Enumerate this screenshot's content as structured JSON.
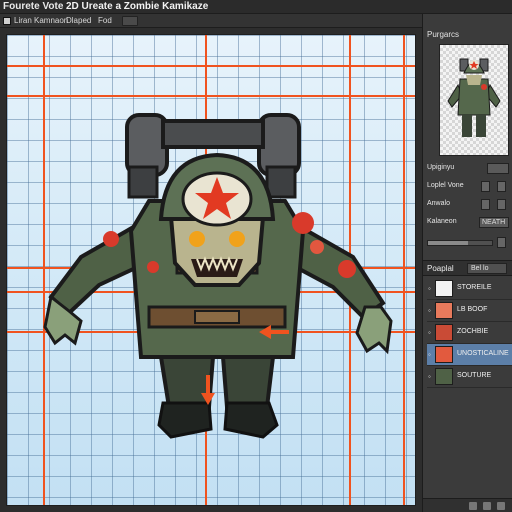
{
  "titlebar": {
    "app_title": "Fourete Vote",
    "document_title": "2D Ureate a Zombie Kamikaze"
  },
  "options_bar": {
    "left_label": "Liran Kamnaon",
    "middle_label": "Dlaped",
    "right_label": "Fod"
  },
  "panel": {
    "tab_title": "Purgarcs",
    "properties": [
      {
        "label": "Upiginyu",
        "value": ""
      },
      {
        "label": "Loplel Vone",
        "value": ""
      },
      {
        "label": "Anwalo",
        "value": ""
      },
      {
        "label": "Kalaneon",
        "value": "NEATH"
      }
    ],
    "layers_title": "Poaplal",
    "layers_mode": "Bel lo",
    "layers": [
      {
        "name": "STOREILE",
        "selected": false
      },
      {
        "name": "LB BOOF",
        "selected": false
      },
      {
        "name": "ZOCHBIE",
        "selected": false
      },
      {
        "name": "UNOSTICALINE",
        "selected": true
      },
      {
        "name": "SOUTURE",
        "selected": false
      }
    ]
  },
  "colors": {
    "guide": "#f0531f",
    "selection": "#5c7fa8",
    "panel_bg": "#3b3b3b"
  }
}
